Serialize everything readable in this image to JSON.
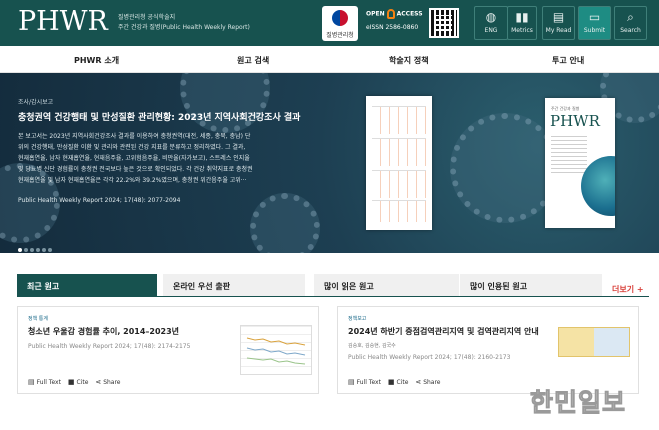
{
  "header": {
    "logo": "PHWR",
    "subtitle_line1": "질병관리청 공식학술지",
    "subtitle_line2": "주간 건강과 질병(Public Health Weekly Report)",
    "agency_label": "질병관리청",
    "open_access_left": "OPEN",
    "open_access_right": "ACCESS",
    "issn": "eISSN 2586-0860",
    "buttons": [
      {
        "label": "ENG",
        "icon": "globe-icon"
      },
      {
        "label": "Metrics",
        "icon": "bar-chart-icon"
      },
      {
        "label": "My Read",
        "icon": "book-icon"
      },
      {
        "label": "Submit",
        "icon": "monitor-icon"
      },
      {
        "label": "Search",
        "icon": "search-icon"
      }
    ]
  },
  "menu": {
    "items": [
      "PHWR 소개",
      "원고 검색",
      "학술지 정책",
      "투고 안내"
    ]
  },
  "hero": {
    "category": "조사/감시보고",
    "title": "충청권역 건강행태 및 만성질환 관리현황: 2023년 지역사회건강조사 결과",
    "body_lines": [
      "본 보고서는 2023년 지역사회건강조사 결과를 이용하여 충청권역(대전, 세종, 충북, 충남) 단",
      "위의 건강행태, 만성질환 이환 및 관리와 관련된 건강 지표를 분류하고 정리하였다. 그 결과,",
      "현재흡연율, 남자 현재흡연율, 현재음주율, 고위험음주율, 비만율(자가보고), 스트레스 인지율",
      "및 당뇨병 신단 경험률이 충청권 전국보다 높은 것으로 확인되었다. 각 건강 취약지표로 충청권",
      "현재흡연율 및 남자 현재흡연율은 각각 22.2%와 39.2%였으며, 충청권 위간음주율 고위···"
    ],
    "citation": "Public Health Weekly Report 2024; 17(48): 2077-2094",
    "slides": 6,
    "active_slide": 0,
    "cover_subtitle": "주간 건강과 질병",
    "cover_logo": "PHWR"
  },
  "tabs": {
    "items": [
      "최근 원고",
      "온라인 우선 출판",
      "많이 읽은 원고",
      "많이 인용된 원고"
    ],
    "active": 0,
    "more_label": "더보기 +"
  },
  "cards": [
    {
      "category": "정책 통계",
      "title": "청소년 우울감 경험률 추이, 2014–2023년",
      "authors": "",
      "citation": "Public Health Weekly Report 2024; 17(48): 2174-2175",
      "actions": [
        "Full Text",
        "Cite",
        "Share"
      ]
    },
    {
      "category": "정책보고",
      "title": "2024년 하반기 중점검역관리지역 및 검역관리지역 안내",
      "authors": "김승호, 김승현, 김국수",
      "citation": "Public Health Weekly Report 2024; 17(48): 2160-2173",
      "actions": [
        "Full Text",
        "Cite",
        "Share"
      ]
    }
  ],
  "watermark": "한민일보",
  "colors": {
    "brand": "#17524f",
    "accent": "#d9403a",
    "submit": "#1e8c83"
  }
}
